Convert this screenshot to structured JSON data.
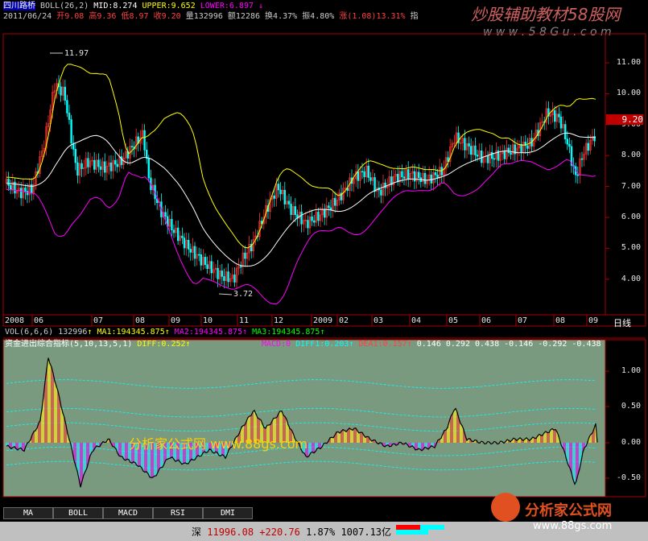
{
  "header": {
    "stock_name": "四川路桥",
    "boll_label": "BOLL(26,2)",
    "mid": "MID:8.274",
    "upper": "UPPER:9.652",
    "lower": "LOWER:6.897",
    "date": "2011/06/24",
    "open": "开9.08",
    "high": "高9.36",
    "low": "低8.97",
    "close": "收9.20",
    "volume": "量132996",
    "amount": "额12286",
    "turnover": "换4.37%",
    "amplitude": "振4.80%",
    "change": "涨(1.08)13.31%",
    "indicator": "指"
  },
  "watermark_top": "炒股辅助教材58股网",
  "watermark_top_url": "w w w . 5 8 G u . c o m",
  "watermark_mid": "分析家公式网 www.88gs.com",
  "watermark_bottom": "分析家公式网",
  "watermark_bottom_url": "www.88gs.com",
  "price_axis": [
    "11.00",
    "10.00",
    "9.00",
    "8.00",
    "7.00",
    "6.00",
    "5.00",
    "4.00"
  ],
  "price_label": "9.20",
  "hi_marker": "11.97",
  "lo_marker": "3.72",
  "x_axis": [
    "2008",
    "06",
    "07",
    "08",
    "09",
    "10",
    "11",
    "12",
    "2009",
    "02",
    "03",
    "04",
    "05",
    "06",
    "07",
    "08",
    "09"
  ],
  "x_axis_right": "日线",
  "vol_line": {
    "label": "VOL(6,6,6)",
    "v": "132996",
    "ma1": "MA1:194345.875",
    "ma2": "MA2:194345.875",
    "ma3": "MA3:194345.875"
  },
  "macd_line": {
    "label": "资金进出综合指标(5,10,13,5,1)",
    "diff": "DIFF:0.252",
    "macd": "MACD:0",
    "diff1": "DIFF1:0.203",
    "dea": "DEA1:0.157",
    "values": "0.146  0.292  0.438  -0.146  -0.292  -0.438"
  },
  "ind_axis": [
    "1.00",
    "0.50",
    "0.00",
    "-0.50"
  ],
  "tabs": [
    "MA",
    "BOLL",
    "MACD",
    "RSI",
    "DMI"
  ],
  "status_bar": {
    "market": "深",
    "index": "11996.08",
    "delta": "+220.76",
    "pct": "1.87%",
    "amount": "1007.13亿"
  },
  "colors": {
    "bg": "#000000",
    "up": "#ff3030",
    "down": "#00ffff",
    "mid_line": "#ffffff",
    "upper_line": "#ffff00",
    "lower_line": "#ff00ff",
    "grid": "#aa0000",
    "panel": "#7a9a80"
  }
}
